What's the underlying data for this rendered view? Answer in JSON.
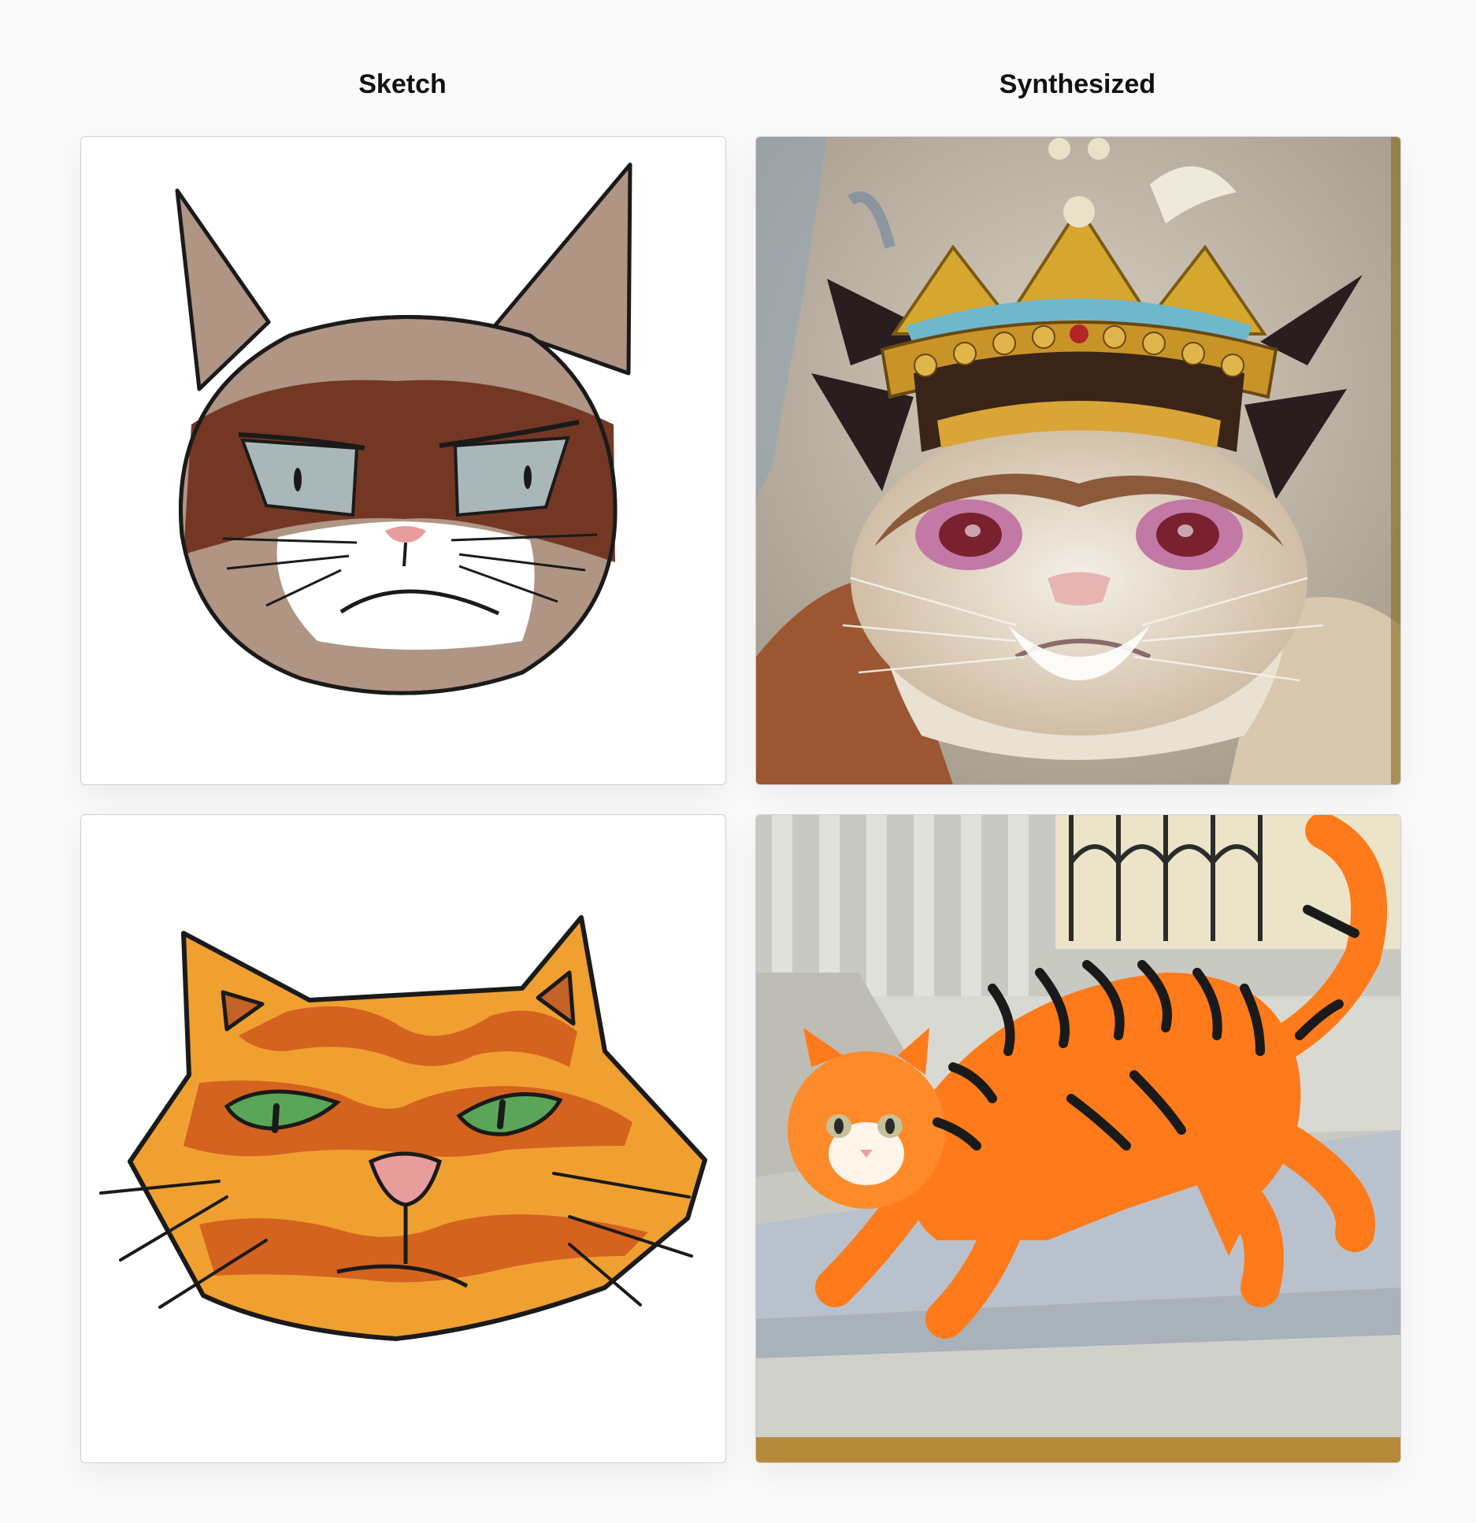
{
  "headers": {
    "sketch": "Sketch",
    "synthesized": "Synthesized"
  },
  "rows": [
    {
      "sketch_icon": "grumpy-cat-sketch",
      "synth_icon": "crowned-grumpy-cat-painting"
    },
    {
      "sketch_icon": "orange-tabby-cat-sketch",
      "synth_icon": "orange-tiger-cat-painting"
    }
  ],
  "colors": {
    "background": "#fafafa",
    "panel_border": "#cfcfcf",
    "outline": "#1a1a1a",
    "grumpy_fur": "#b09484",
    "grumpy_mask": "#733724",
    "grumpy_eye": "#a9b7b9",
    "orange_fur": "#f0a030",
    "orange_stripe": "#d46320",
    "orange_eye": "#5aa558",
    "nose_pink": "#e89c9c"
  }
}
